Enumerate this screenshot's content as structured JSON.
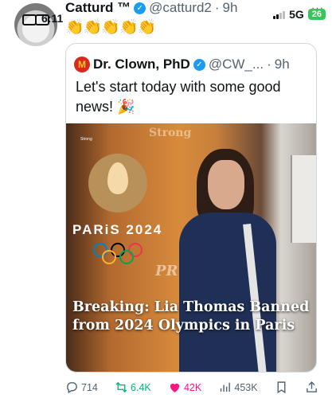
{
  "status_bar": {
    "network": "5G",
    "battery": "26"
  },
  "post": {
    "time_overlay": "6:11",
    "author_name": "Catturd ™",
    "author_handle": "@catturd2",
    "separator": "·",
    "age": "9h",
    "more_label": "···",
    "body": "👏👏👏👏👏"
  },
  "quoted": {
    "author_name": "Dr. Clown, PhD",
    "author_handle": "@CW_...",
    "separator": "·",
    "age": "9h",
    "text": "Let's start today with some good news! 🎉",
    "image": {
      "watermark": "Strong",
      "watermark_small": "Strong",
      "logo_text": "PARiS 2024",
      "jacket_text": "PR",
      "caption": "Breaking: Lia Thomas Banned from 2024 Olympics in Paris"
    }
  },
  "actions": {
    "replies": "714",
    "reposts": "6.4K",
    "likes": "42K",
    "views": "453K"
  },
  "colors": {
    "accent": "#1d9bf0",
    "repost": "#00ba7c",
    "like": "#f91880",
    "muted": "#536471"
  }
}
